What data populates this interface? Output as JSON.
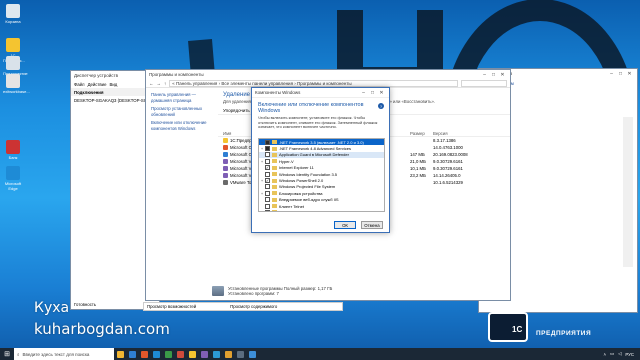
{
  "desktop": {
    "icons": [
      {
        "label": "Корзина",
        "color": "#dfe8ef"
      },
      {
        "label": "1С Предприя...",
        "color": "#f4c430"
      },
      {
        "label": "Предприятие",
        "color": "#d9e2ea"
      },
      {
        "label": "exitworkbase...",
        "color": "#e4e4e4"
      },
      {
        "label": "Банк",
        "color": "#cc3333"
      },
      {
        "label": "Microsoft Edge",
        "color": "#1e8bd6"
      }
    ]
  },
  "devmgr": {
    "title": "Диспетчер устройств",
    "menu": [
      "Файл",
      "Действие",
      "Вид",
      "Справка"
    ],
    "header": "Подключения",
    "items": [
      "DESKTOP-SGAKAQ3 (DESKTOP-SGAKAQ3)",
      "DESKTOP-SGAKAQ3 (DESKTOP-SGAKAQ3)"
    ],
    "status": "Готовность"
  },
  "programs": {
    "title": "Программы и компоненты",
    "address": "« Панель управления › Все элементы панели управления › Программы и компоненты",
    "nav": [
      "Панель управления — домашняя страница",
      "Просмотр установленных обновлений",
      "Включение или отключение компонентов Windows"
    ],
    "heading": "Удаление или изменение программы",
    "subtitle": "Для удаления программы выберите её в списке и щелкните «Удалить», «Изменить» или «Восстановить».",
    "toolbar_label": "Упорядочить",
    "columns": {
      "name": "Имя",
      "size": "Размер",
      "version": "Версия"
    },
    "rows": [
      {
        "name": "1С:Предприятие",
        "size": "",
        "version": "8.3.17.1386",
        "color": "#f4c430"
      },
      {
        "name": "Microsoft Office",
        "size": "",
        "version": "14.0.4763.1000",
        "color": "#e2572b"
      },
      {
        "name": "Microsoft OneDrive",
        "size": "147 МБ",
        "version": "20.169.0823.0008",
        "color": "#2f7fd3"
      },
      {
        "name": "Microsoft Visual C++",
        "size": "21,0 МБ",
        "version": "9.0.30729.6161",
        "color": "#7f5fb5"
      },
      {
        "name": "Microsoft Visual C++",
        "size": "10,1 МБ",
        "version": "9.0.30729.6161",
        "color": "#7f5fb5"
      },
      {
        "name": "Microsoft Visual C++",
        "size": "23,2 МБ",
        "version": "14.14.26405.0",
        "color": "#7f5fb5"
      },
      {
        "name": "VMware Tools",
        "size": "",
        "version": "10.1.6.5214329",
        "color": "#6a6a6a"
      }
    ],
    "extra_dates": [
      "1.2020",
      "2.2020",
      "2.2020",
      "2.2020",
      "2.2020",
      "2.2020"
    ],
    "extra_sizes": [
      "602 МБ"
    ],
    "status_line": "Установленные программы   Полный размер: 1,17 ГБ",
    "status_count": "Установлено программ: 7"
  },
  "rightpanel": {
    "title": "...ми серверов",
    "hint": "...ие сервером",
    "footer": ""
  },
  "components": {
    "title": "Компоненты Windows",
    "heading": "Включение или отключение компонентов Windows",
    "description": "Чтобы включить компонент, установите его флажок. Чтобы отключить компонент, снимите его флажок. Затемненный флажок означает, что компонент включен частично.",
    "items": [
      {
        "label": ".NET Framework 3.5 (включает .NET 2.0 и 3.0)",
        "expander": "+",
        "check": "part",
        "state": "sel"
      },
      {
        "label": ".NET Framework 4.8 Advanced Services",
        "expander": "+",
        "check": "part",
        "state": ""
      },
      {
        "label": "Application Guard в Microsoft Defender",
        "expander": "",
        "check": "",
        "state": "hi"
      },
      {
        "label": "Hyper-V",
        "expander": "+",
        "check": "",
        "state": ""
      },
      {
        "label": "Internet Explorer 11",
        "expander": "",
        "check": "on",
        "state": ""
      },
      {
        "label": "Windows Identity Foundation 3.5",
        "expander": "",
        "check": "",
        "state": ""
      },
      {
        "label": "Windows PowerShell 2.0",
        "expander": "+",
        "check": "on",
        "state": ""
      },
      {
        "label": "Windows Projected File System",
        "expander": "",
        "check": "",
        "state": ""
      },
      {
        "label": "Блокировка устройства",
        "expander": "+",
        "check": "",
        "state": ""
      },
      {
        "label": "Внедряемое веб-ядро служб IIS",
        "expander": "",
        "check": "",
        "state": ""
      },
      {
        "label": "Клиент Telnet",
        "expander": "",
        "check": "",
        "state": ""
      },
      {
        "label": "Клиент TFTP",
        "expander": "",
        "check": "",
        "state": ""
      }
    ],
    "ok": "ОК",
    "cancel": "Отмена"
  },
  "bottom_tabs": {
    "left": "Просмотр возможностей",
    "right": "Просмотр содержимого"
  },
  "taskbar": {
    "search_placeholder": "Введите здесь текст для поиска",
    "apps": [
      "#f2b632",
      "#2f7fd3",
      "#e2572b",
      "#1e8bd6",
      "#3a9a48",
      "#d04b3c",
      "#f4c430",
      "#7f5fb5",
      "#2c9ad6",
      "#e0a030",
      "#5b6d80",
      "#3d8fd9"
    ],
    "language": "РУС",
    "time": "",
    "date": ""
  },
  "watermark": {
    "name": "Куха",
    "site": "kuharbogdan.com",
    "brand_top": "НИСТРАТОР",
    "brand_mid": "1С",
    "brand_bottom": "ПРЕДПРИЯТИЯ"
  }
}
